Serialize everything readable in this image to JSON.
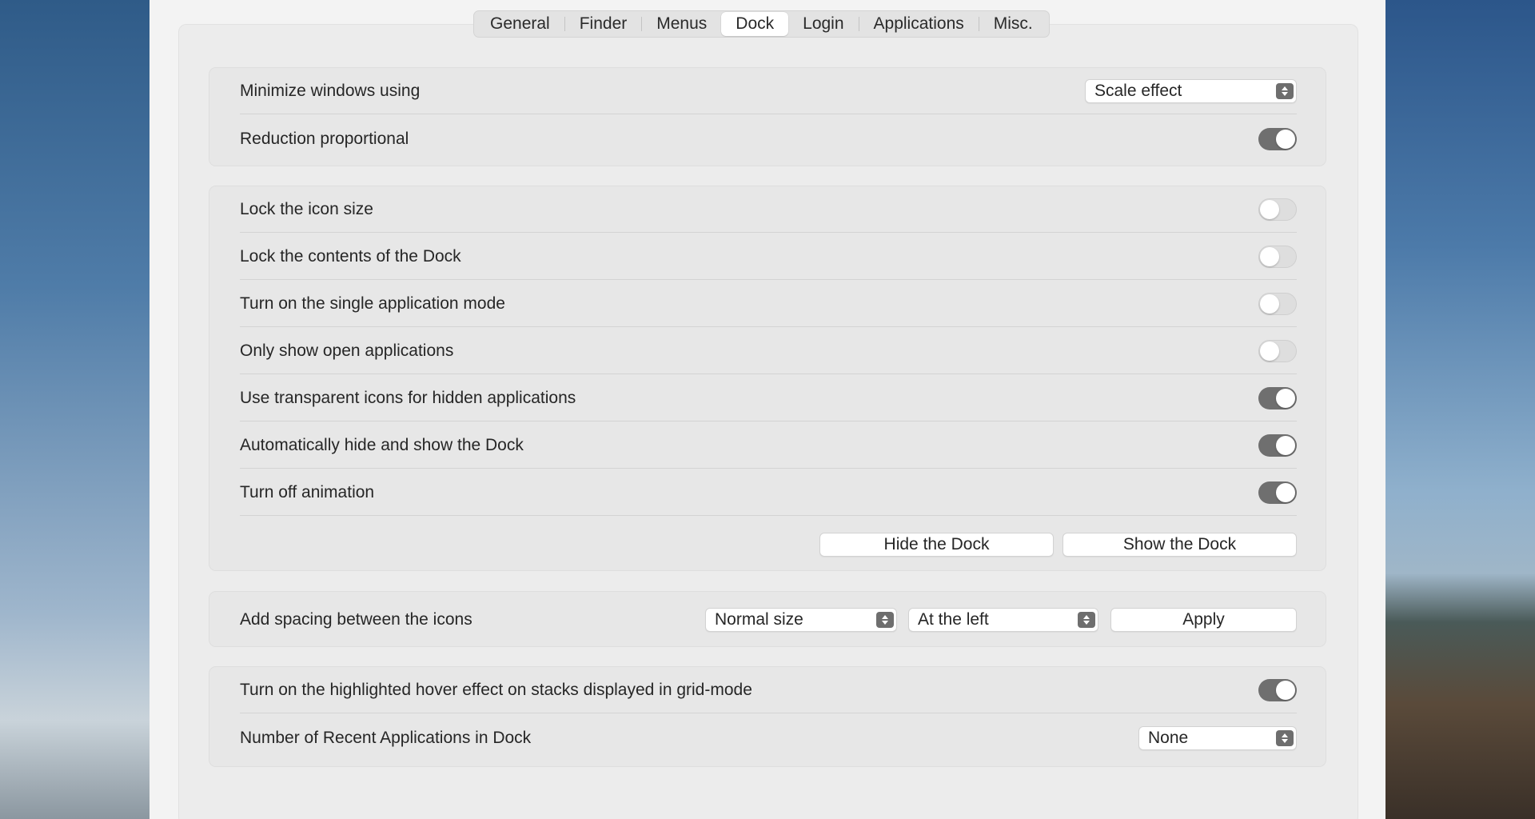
{
  "tabs": [
    {
      "label": "General"
    },
    {
      "label": "Finder"
    },
    {
      "label": "Menus"
    },
    {
      "label": "Dock",
      "active": true
    },
    {
      "label": "Login"
    },
    {
      "label": "Applications"
    },
    {
      "label": "Misc."
    }
  ],
  "group1": {
    "minimize_label": "Minimize windows using",
    "minimize_value": "Scale effect",
    "reduction_label": "Reduction proportional",
    "reduction_on": true
  },
  "group2": {
    "rows": [
      {
        "label": "Lock the icon size",
        "on": false
      },
      {
        "label": "Lock the contents of the Dock",
        "on": false
      },
      {
        "label": "Turn on the single application mode",
        "on": false
      },
      {
        "label": "Only show open applications",
        "on": false
      },
      {
        "label": "Use transparent icons for hidden applications",
        "on": true
      },
      {
        "label": "Automatically hide and show the Dock",
        "on": true
      },
      {
        "label": "Turn off animation",
        "on": true
      }
    ],
    "hide_button": "Hide the Dock",
    "show_button": "Show the Dock"
  },
  "group3": {
    "spacing_label": "Add spacing between the icons",
    "size_value": "Normal size",
    "position_value": "At the left",
    "apply_button": "Apply"
  },
  "group4": {
    "hover_label": "Turn on the highlighted hover effect on stacks displayed in grid-mode",
    "hover_on": true,
    "recent_label": "Number of Recent Applications in Dock",
    "recent_value": "None"
  },
  "colors": {
    "toggle_on": "#6f6f6f",
    "toggle_off": "#dedede",
    "window_bg": "#f3f3f3"
  }
}
